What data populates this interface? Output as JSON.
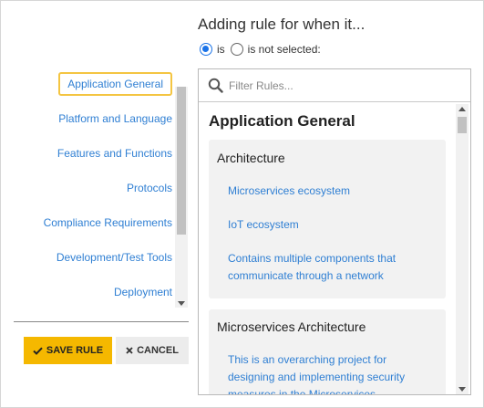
{
  "header": {
    "title": "Adding rule for when it..."
  },
  "selection": {
    "is_label": "is",
    "is_not_label": "is not selected:",
    "selected": "is"
  },
  "sidebar": {
    "items": [
      {
        "label": "Application General",
        "active": true
      },
      {
        "label": "Platform and Language",
        "active": false
      },
      {
        "label": "Features and Functions",
        "active": false
      },
      {
        "label": "Protocols",
        "active": false
      },
      {
        "label": "Compliance Requirements",
        "active": false
      },
      {
        "label": "Development/Test Tools",
        "active": false
      },
      {
        "label": "Deployment",
        "active": false
      }
    ]
  },
  "actions": {
    "save_label": "SAVE RULE",
    "cancel_label": "CANCEL"
  },
  "search": {
    "placeholder": "Filter Rules..."
  },
  "rules": {
    "section_title": "Application General",
    "groups": [
      {
        "title": "Architecture",
        "items": [
          "Microservices ecosystem",
          "IoT ecosystem",
          "Contains multiple components that communicate through a network"
        ]
      },
      {
        "title": "Microservices Architecture",
        "items": [
          "This is an overarching project for designing and implementing security measures in the Microservices"
        ]
      }
    ]
  },
  "colors": {
    "accent": "#f5b800",
    "link": "#2f7fd3",
    "radio": "#1a73e8",
    "active_outline": "#f4c542"
  }
}
